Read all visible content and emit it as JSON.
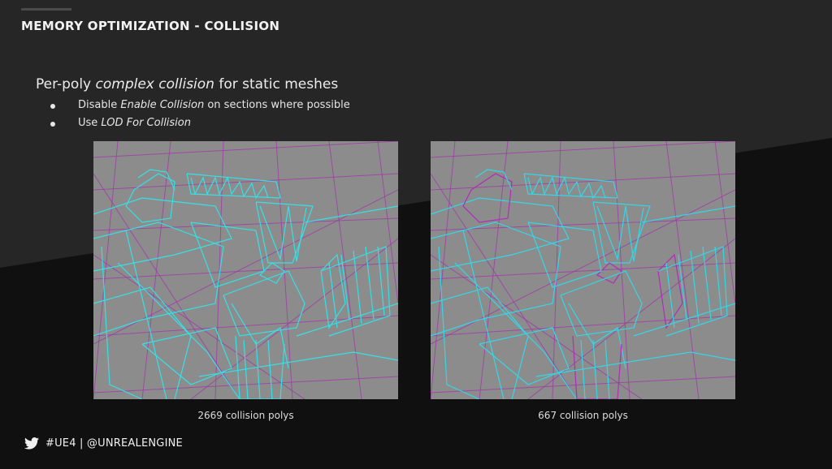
{
  "title": "MEMORY OPTIMIZATION - COLLISION",
  "heading": {
    "prefix": "Per-poly ",
    "italic": "complex collision",
    "suffix": " for static meshes"
  },
  "bullets": [
    {
      "prefix": "Disable ",
      "italic": "Enable Collision",
      "suffix": " on sections where possible"
    },
    {
      "prefix": "Use ",
      "italic": "LOD For Collision",
      "suffix": ""
    }
  ],
  "panels": [
    {
      "caption": "2669 collision polys",
      "wire_color": "#35e0e6",
      "accent_color": "#35e0e6"
    },
    {
      "caption": "667 collision polys",
      "wire_color": "#35d6e6",
      "accent_color": "#b02cb8"
    }
  ],
  "footer": {
    "text": "#UE4 | @UNREALENGINE",
    "icon": "twitter-bird-icon"
  },
  "colors": {
    "background": "#1c1c1c",
    "grid": "#a03aa8",
    "panel": "#8c8c8c"
  }
}
